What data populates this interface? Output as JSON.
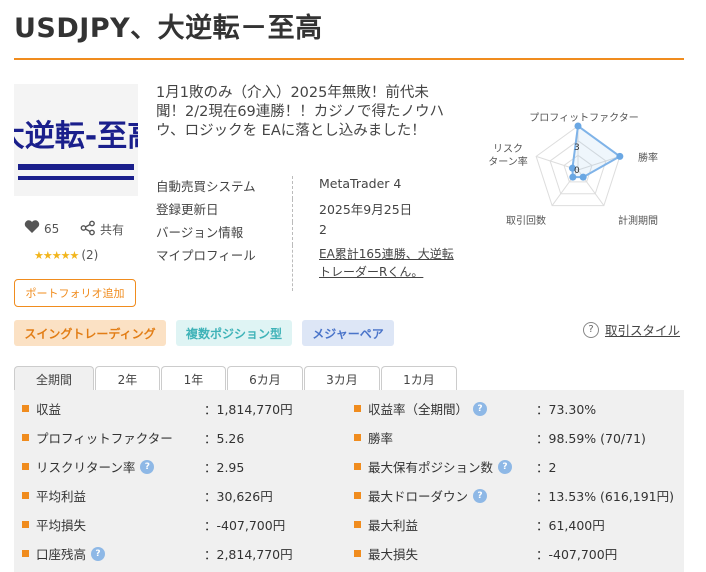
{
  "page_title": "USDJPY、大逆転－至高",
  "product": {
    "image_text": "大逆転-至高",
    "likes": "65",
    "share_label": "共有",
    "stars": "★★★★★",
    "rating_count": "(2)",
    "portfolio_button": "ポートフォリオ追加",
    "description": "1月1敗のみ（介入）2025年無敗！前代未聞！2/2現在69連勝！！カジノで得たノウハウ、ロジックを EAに落とし込みました！"
  },
  "info": [
    {
      "label": "自動売買システム",
      "value": "MetaTrader 4"
    },
    {
      "label": "登録更新日",
      "value": "2025年9月25日"
    },
    {
      "label": "バージョン情報",
      "value": "2"
    },
    {
      "label": "マイプロフィール",
      "value_line1": "EA累計165連勝、大逆転",
      "value_line2": "トレーダーRくん。"
    }
  ],
  "radar": {
    "labels": {
      "top": "プロフィットファクター",
      "right": "勝率",
      "bottom_right": "計測期間",
      "bottom_left": "取引回数",
      "left_line1": "リスク",
      "left_line2": "ターン率"
    },
    "scale_max": "3",
    "scale_min": "0",
    "values": {
      "profit_factor": 3,
      "win_rate": 3,
      "period": 0.6,
      "trades": 0.6,
      "risk_return": 0.4
    },
    "line_color": "#7fb3e8",
    "point_color": "#6aa7e3"
  },
  "tags": [
    "スイングトレーディング",
    "複数ポジション型",
    "メジャーペア"
  ],
  "trade_style_link": "取引スタイル",
  "tabs": [
    "全期間",
    "2年",
    "1年",
    "6カ月",
    "3カ月",
    "1カ月"
  ],
  "stats_left": [
    {
      "label": "収益",
      "value": "：1,814,770円",
      "help": false
    },
    {
      "label": "プロフィットファクター",
      "value": "：5.26",
      "help": false
    },
    {
      "label": "リスクリターン率",
      "value": "：2.95",
      "help": true
    },
    {
      "label": "平均利益",
      "value": "：30,626円",
      "help": false
    },
    {
      "label": "平均損失",
      "value": "：-407,700円",
      "help": false
    },
    {
      "label": "口座残高",
      "value": "：2,814,770円",
      "help": true
    }
  ],
  "stats_right": [
    {
      "label": "収益率（全期間）",
      "value": "：73.30%",
      "help": true
    },
    {
      "label": "勝率",
      "value": "：98.59% (70/71)",
      "help": false
    },
    {
      "label": "最大保有ポジション数",
      "value": "：2",
      "help": true
    },
    {
      "label": "最大ドローダウン",
      "value": "：13.53% (616,191円)",
      "help": true
    },
    {
      "label": "最大利益",
      "value": "：61,400円",
      "help": false
    },
    {
      "label": "最大損失",
      "value": "：-407,700円",
      "help": false
    }
  ],
  "colors": {
    "accent": "#f08c1e",
    "help_icon": "#8eb8e6"
  }
}
